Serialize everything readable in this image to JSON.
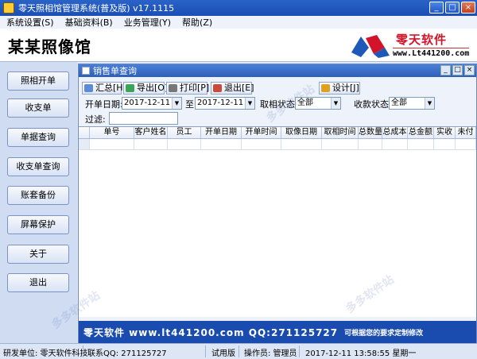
{
  "window": {
    "title": "零天照相馆管理系统(普及版)   v17.1115",
    "min": "_",
    "max": "□",
    "close": "×"
  },
  "menu": [
    "系统设置(S)",
    "基础资料(B)",
    "业务管理(Y)",
    "帮助(Z)"
  ],
  "header": {
    "company_name": "某某照像馆",
    "logo_text": "零天软件",
    "logo_url": "www.Lt441200.com"
  },
  "sidebar": [
    "照相开单",
    "收支单",
    "单据查询",
    "收支单查询",
    "账套备份",
    "屏幕保护",
    "关于",
    "退出"
  ],
  "child": {
    "title": "销售单查询",
    "toolbar": {
      "summary": "汇总[H]",
      "export": "导出[O]",
      "print": "打印[P]",
      "exit": "退出[E]",
      "design": "设计[J]"
    },
    "filters": {
      "date_label": "开单日期:",
      "date_from": "2017-12-11",
      "to_label": "至",
      "date_to": "2017-12-11",
      "pickup_label": "取相状态:",
      "pickup_value": "全部",
      "payment_label": "收款状态:",
      "payment_value": "全部",
      "filter_label": "过滤:"
    },
    "columns": [
      "",
      "单号",
      "客户姓名",
      "员工",
      "开单日期",
      "开单时间",
      "取像日期",
      "取相时间",
      "总数量",
      "总成本",
      "总金额",
      "实收",
      "未付"
    ]
  },
  "banner": {
    "main": "零天软件  www.lt441200.com  QQ:271125727",
    "note": "可根据您的要求定制修改"
  },
  "status": {
    "developer": "研发单位: 零天软件科技",
    "qq": "联系QQ: 271125727",
    "edition": "试用版",
    "operator": "操作员: 管理员",
    "datetime": "2017-12-11  13:58:55  星期一"
  },
  "watermark": "多多软件站",
  "colors": {
    "titlebar": "#1b4fb5",
    "banner": "#1a4cb0",
    "logo_red": "#d3132a"
  }
}
